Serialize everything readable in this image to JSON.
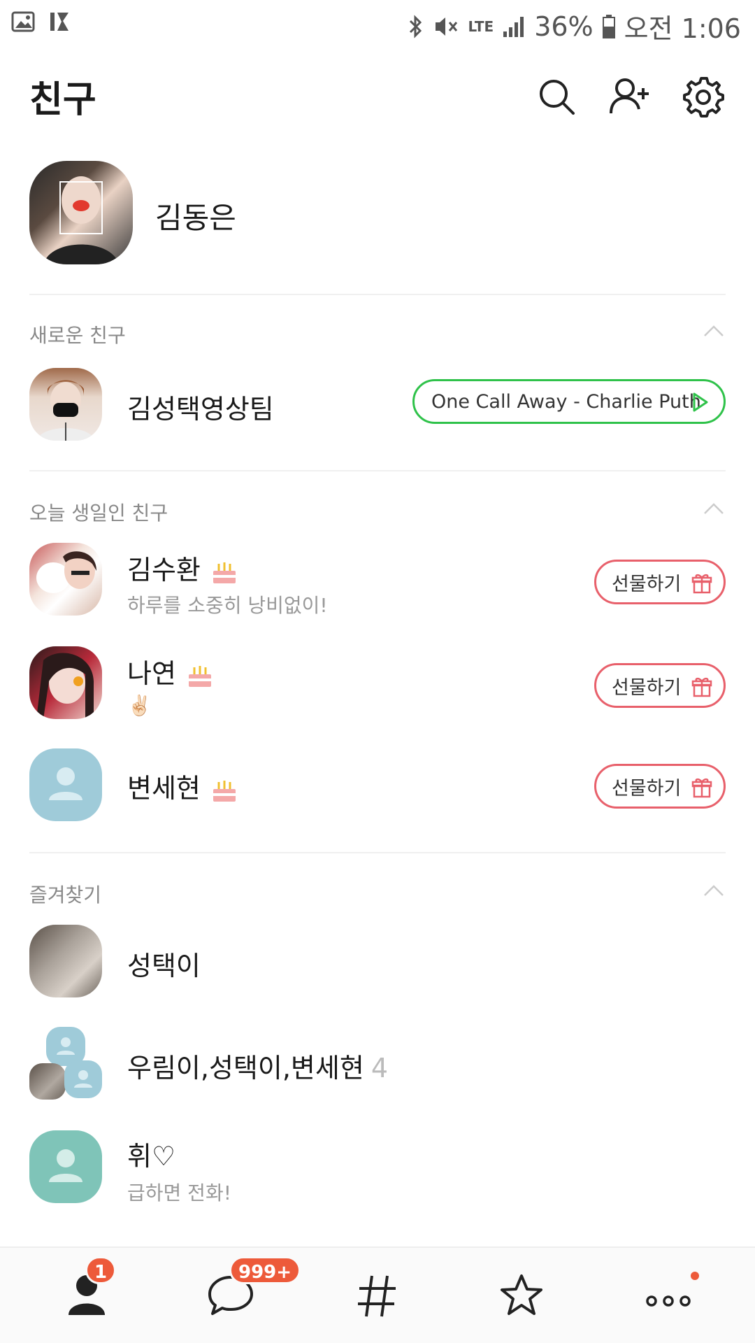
{
  "status_bar": {
    "battery": "36%",
    "time": "오전 1:06",
    "network": "LTE"
  },
  "header": {
    "title": "친구"
  },
  "my_profile": {
    "name": "김동은"
  },
  "new_friends": {
    "title": "새로운 친구",
    "items": [
      {
        "name": "김성택영상팀",
        "music": "One Call Away - Charlie Puth"
      }
    ]
  },
  "birthday": {
    "title": "오늘 생일인 친구",
    "gift_label": "선물하기",
    "items": [
      {
        "name": "김수환",
        "status": "하루를 소중히 낭비없이!"
      },
      {
        "name": "나연",
        "status": "✌🏻"
      },
      {
        "name": "변세현",
        "status": ""
      }
    ]
  },
  "favorites": {
    "title": "즐겨찾기",
    "items": [
      {
        "name": "성택이",
        "status": ""
      },
      {
        "name": "우림이,성택이,변세현",
        "count": "4",
        "status": ""
      },
      {
        "name": "휘♡",
        "status": "급하면 전화!"
      }
    ]
  },
  "bottom_nav": {
    "friends_badge": "1",
    "chats_badge": "999+"
  },
  "colors": {
    "music_green": "#2fc24a",
    "gift_red": "#e8606b",
    "badge_red": "#ed5a3a"
  }
}
